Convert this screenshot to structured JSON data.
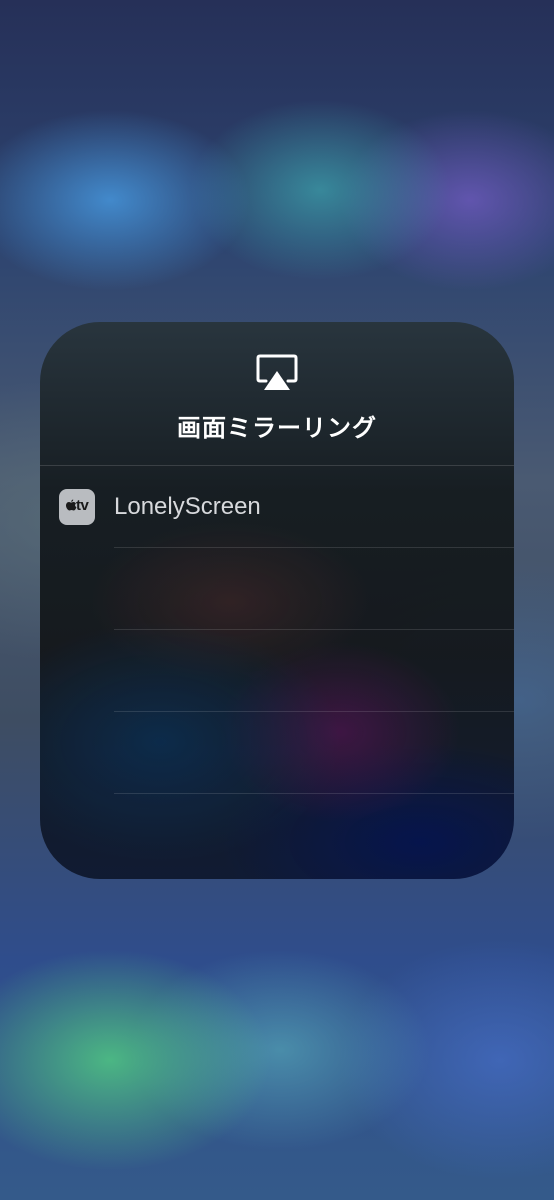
{
  "screen": {
    "title": "画面ミラーリング",
    "icon": "airplay-icon"
  },
  "devices": [
    {
      "name": "LonelyScreen",
      "icon": "apple-tv-icon",
      "icon_label": "tv"
    }
  ],
  "colors": {
    "title_text": "#ffffff",
    "device_text": "#d7d9dc",
    "device_icon_bg": "#b9bcc0"
  }
}
